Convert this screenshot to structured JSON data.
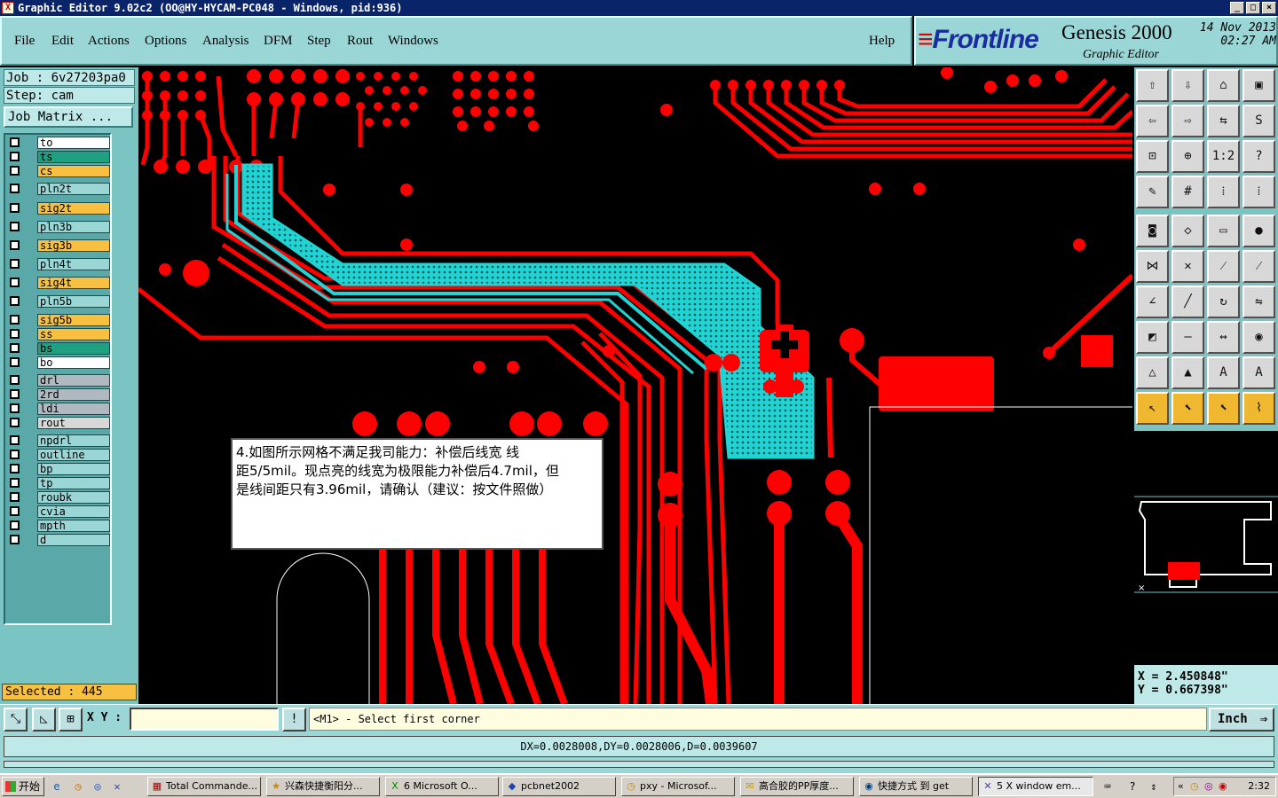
{
  "window": {
    "title": "Graphic Editor 9.02c2 (OO@HY-HYCAM-PC048 - Windows, pid:936)"
  },
  "menu": [
    "File",
    "Edit",
    "Actions",
    "Options",
    "Analysis",
    "DFM",
    "Step",
    "Rout",
    "Windows"
  ],
  "help_label": "Help",
  "brand": {
    "logo": "Frontline",
    "product": "Genesis 2000",
    "subtitle": "Graphic Editor",
    "date": "14 Nov 2013",
    "time": "02:27 AM"
  },
  "job": {
    "job_label": "Job : 6v27203pa0",
    "step_label": "Step: cam",
    "matrix_button": "Job Matrix ..."
  },
  "layers": [
    {
      "name": "to",
      "color": "#ffffff"
    },
    {
      "name": "ts",
      "color": "#1fa080"
    },
    {
      "name": "cs",
      "color": "#f7c040"
    },
    {
      "name": "pln2t",
      "color": "#9bd6d6"
    },
    {
      "name": "sig2t",
      "color": "#f7c040"
    },
    {
      "name": "pln3b",
      "color": "#9bd6d6"
    },
    {
      "name": "sig3b",
      "color": "#f7c040"
    },
    {
      "name": "pln4t",
      "color": "#9bd6d6"
    },
    {
      "name": "sig4t",
      "color": "#f7c040"
    },
    {
      "name": "pln5b",
      "color": "#9bd6d6"
    },
    {
      "name": "sig5b",
      "color": "#f7c040"
    },
    {
      "name": "ss",
      "color": "#f7c040"
    },
    {
      "name": "bs",
      "color": "#1fa080"
    },
    {
      "name": "bo",
      "color": "#ffffff"
    },
    {
      "name": "drl",
      "color": "#b0b8c0"
    },
    {
      "name": "2rd",
      "color": "#b0b8c0"
    },
    {
      "name": "ldi",
      "color": "#b0b8c0"
    },
    {
      "name": "rout",
      "color": "#d8d8d8"
    },
    {
      "name": "npdrl",
      "color": "#9bd6d6"
    },
    {
      "name": "outline",
      "color": "#9bd6d6"
    },
    {
      "name": "bp",
      "color": "#9bd6d6"
    },
    {
      "name": "tp",
      "color": "#9bd6d6"
    },
    {
      "name": "roubk",
      "color": "#9bd6d6"
    },
    {
      "name": "cvia",
      "color": "#9bd6d6"
    },
    {
      "name": "mpth",
      "color": "#9bd6d6"
    },
    {
      "name": "d",
      "color": "#9bd6d6"
    }
  ],
  "selected_label": "Selected : 445",
  "note": {
    "line1": "4.如图所示网格不满足我司能力：补偿后线宽 线",
    "line2": "距5/5mil。现点亮的线宽为极限能力补偿后4.7mil，但",
    "line3": "是线间距只有3.96mil，请确认（建议：按文件照做）"
  },
  "coords": {
    "x": "X = 2.450848\"",
    "y": "Y = 0.667398\""
  },
  "command": {
    "xy_label": "X Y :",
    "xy_value": "",
    "message": "<M1> - Select first corner",
    "unit": "Inch"
  },
  "measure": "DX=0.0028008,DY=0.0028006,D=0.0039607",
  "taskbar": {
    "start": "开始",
    "tasks": [
      "Total Commande...",
      "兴森快捷衡阳分...",
      "6 Microsoft O...",
      "pcbnet2002",
      "pxy - Microsof...",
      "高合胶的PP厚度...",
      "快捷方式 到 get",
      "5 X window em..."
    ],
    "clock": "2:32"
  },
  "colors": {
    "copper": "#ff0000",
    "highlight": "#22d3d3",
    "panel": "#9bd6d6"
  }
}
